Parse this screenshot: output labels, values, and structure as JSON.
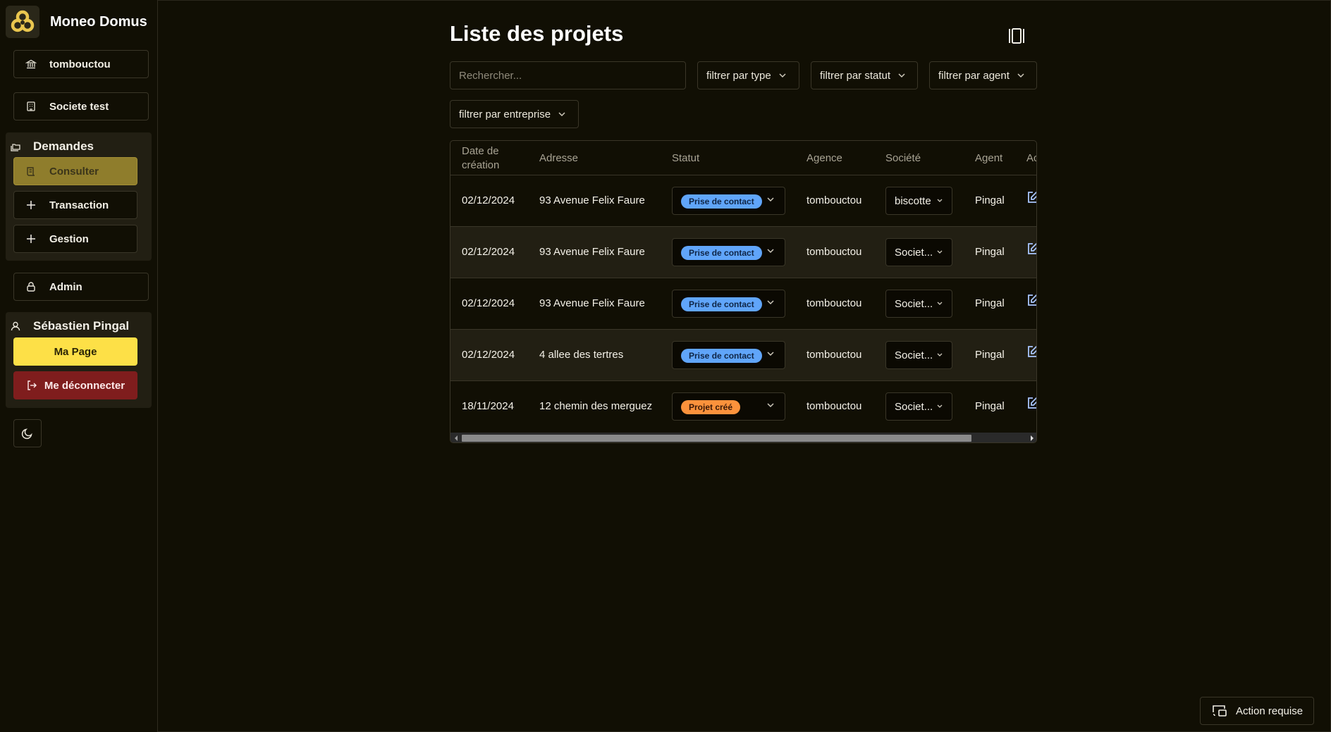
{
  "brand": {
    "name": "Moneo Domus",
    "logo_icon": "triskel-logo"
  },
  "sidebar": {
    "agency": "tombouctou",
    "company": "Societe test",
    "demandes": {
      "label": "Demandes",
      "items": [
        {
          "label": "Consulter",
          "active": true
        },
        {
          "label": "Transaction",
          "active": false
        },
        {
          "label": "Gestion",
          "active": false
        }
      ]
    },
    "admin": "Admin",
    "user": {
      "name": "Sébastien Pingal",
      "my_page": "Ma Page",
      "logout": "Me déconnecter"
    }
  },
  "main": {
    "title": "Liste des projets",
    "search_placeholder": "Rechercher...",
    "filters": {
      "type": "filtrer par type",
      "status": "filtrer par statut",
      "agent": "filtrer par agent",
      "company": "filtrer par entreprise"
    },
    "table": {
      "headers": {
        "date_line1": "Date de",
        "date_line2": "création",
        "address": "Adresse",
        "status": "Statut",
        "agency": "Agence",
        "company": "Société",
        "agent": "Agent",
        "actions": "Ac"
      },
      "rows": [
        {
          "date": "02/12/2024",
          "address": "93 Avenue Felix Faure",
          "status": "Prise de contact",
          "agency": "tombouctou",
          "company": "biscotte",
          "agent": "Pingal"
        },
        {
          "date": "02/12/2024",
          "address": "93 Avenue Felix Faure",
          "status": "Prise de contact",
          "agency": "tombouctou",
          "company": "Societ...",
          "agent": "Pingal"
        },
        {
          "date": "02/12/2024",
          "address": "93 Avenue Felix Faure",
          "status": "Prise de contact",
          "agency": "tombouctou",
          "company": "Societ...",
          "agent": "Pingal"
        },
        {
          "date": "02/12/2024",
          "address": "4 allee des tertres",
          "status": "Prise de contact",
          "agency": "tombouctou",
          "company": "Societ...",
          "agent": "Pingal"
        },
        {
          "date": "18/11/2024",
          "address": "12 chemin des merguez",
          "status": "Projet créé",
          "agency": "tombouctou",
          "company": "Societ...",
          "agent": "Pingal"
        }
      ]
    }
  },
  "action_button": "Action requise",
  "colors": {
    "background": "#110f04",
    "accent_yellow": "#fde047",
    "danger": "#7f1d1d",
    "badge_blue": "#60a5fa",
    "badge_orange": "#fb923c"
  }
}
